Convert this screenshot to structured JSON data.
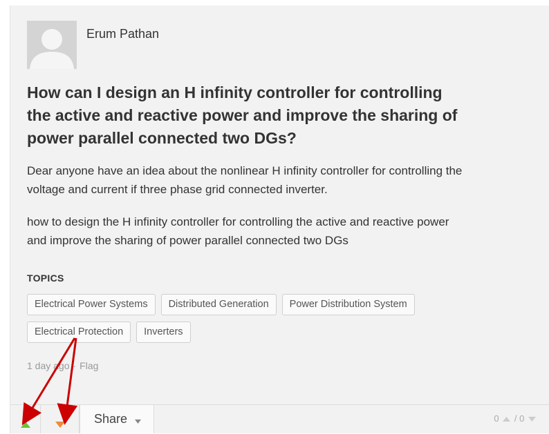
{
  "post": {
    "author": "Erum Pathan",
    "title_lines": [
      "How can I design an H infinity controller for controlling",
      "the active and reactive power and improve the sharing of",
      "power parallel connected two DGs?"
    ],
    "body": [
      [
        "Dear anyone have an idea about the nonlinear H infinity controller for controlling the",
        "voltage and current if three phase grid connected inverter."
      ],
      [
        "how to design the H infinity controller for controlling the active and reactive power",
        "and improve the sharing of power parallel connected two DGs"
      ]
    ],
    "topics_heading": "TOPICS",
    "topics": [
      [
        "Electrical Power Systems",
        "Distributed Generation",
        "Power Distribution System"
      ],
      [
        "Electrical Protection",
        "Inverters"
      ]
    ],
    "time_ago": "1 day ago",
    "separator": "·",
    "flag_label": "Flag"
  },
  "actions": {
    "share_label": "Share",
    "upvote_count": "0",
    "downvote_count": "0",
    "score_separator": "/"
  },
  "colors": {
    "upvote": "#6cbf3c",
    "downvote": "#f08a3c",
    "annotation_arrow": "#cc0000"
  },
  "icons": {
    "avatar": "user-silhouette-icon",
    "upvote": "up-arrow-icon",
    "downvote": "down-arrow-icon",
    "share_caret": "caret-down-icon"
  }
}
